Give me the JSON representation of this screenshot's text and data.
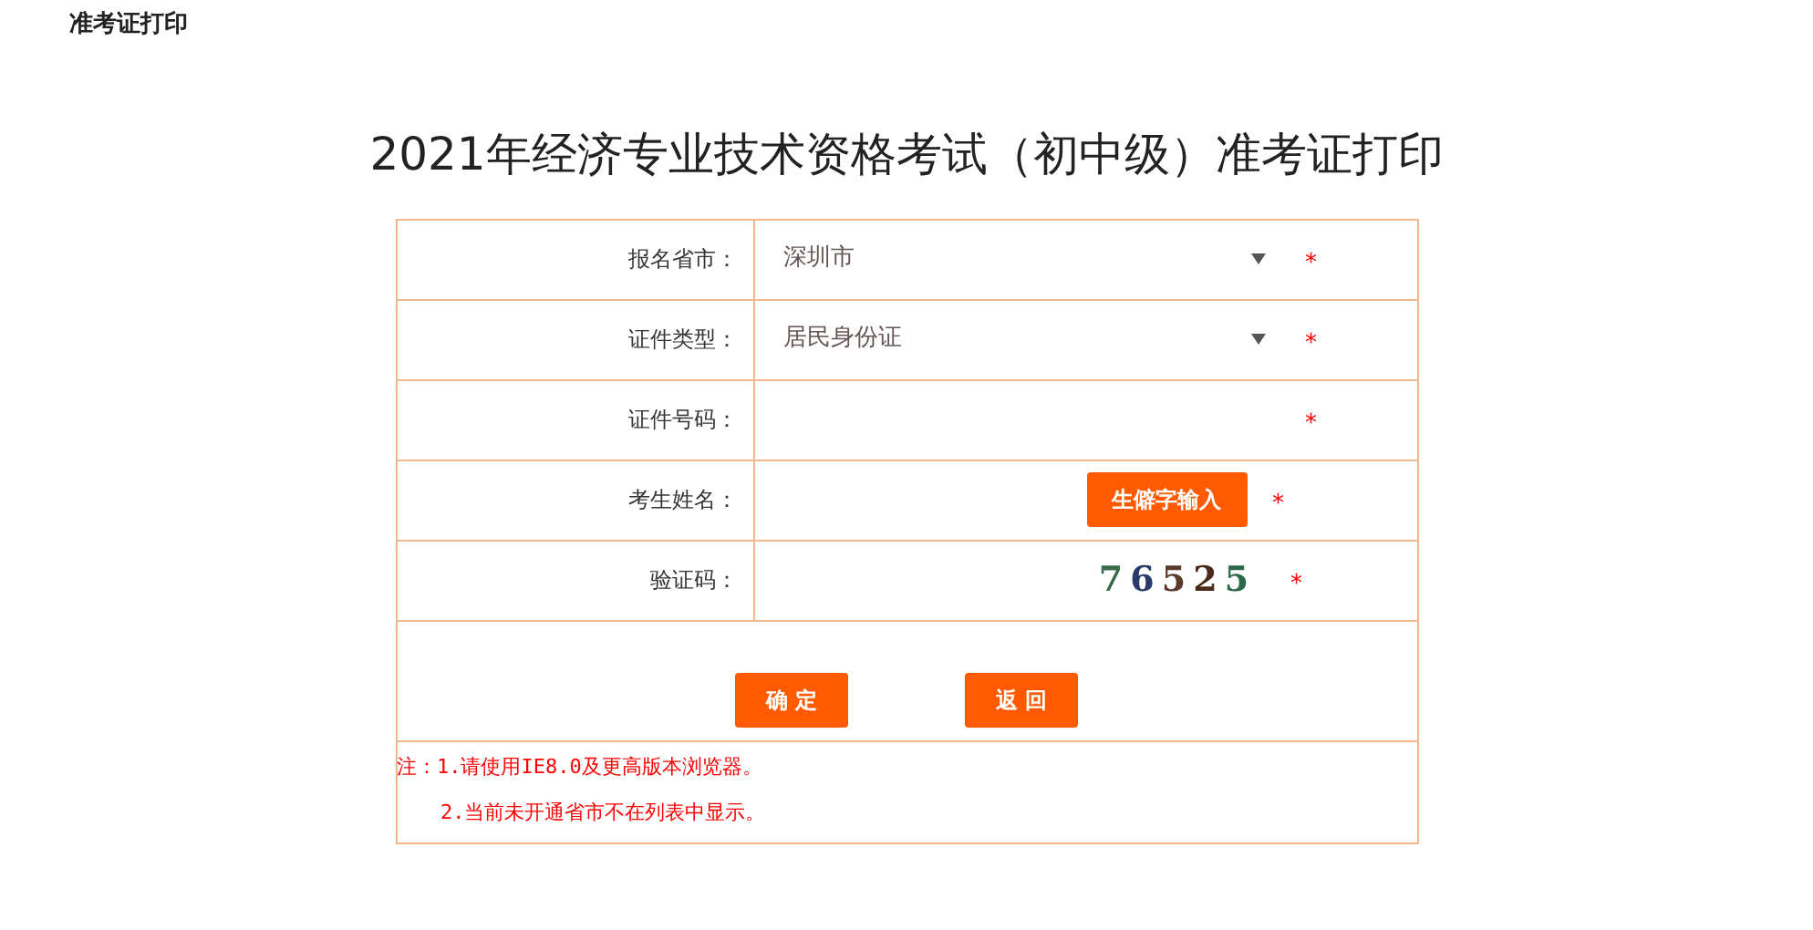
{
  "header": {
    "title": "准考证打印"
  },
  "heading": "2021年经济专业技术资格考试（初中级）准考证打印",
  "form": {
    "rows": [
      {
        "label": "报名省市：",
        "kind": "select",
        "value": "深圳市",
        "mark": "*"
      },
      {
        "label": "证件类型：",
        "kind": "select",
        "value": "居民身份证",
        "mark": "*"
      },
      {
        "label": "证件号码：",
        "kind": "text",
        "mark": "*"
      },
      {
        "label": "考生姓名：",
        "kind": "text-button",
        "button": "生僻字输入",
        "mark": "*"
      },
      {
        "label": "验证码：",
        "kind": "captcha",
        "captcha": "76525",
        "mark": "*"
      }
    ],
    "buttons": [
      "确 定",
      "返 回"
    ],
    "notes": [
      "注：1.请使用IE8.0及更高版本浏览器。",
      "2.当前未开通省市不在列表中显示。"
    ]
  }
}
